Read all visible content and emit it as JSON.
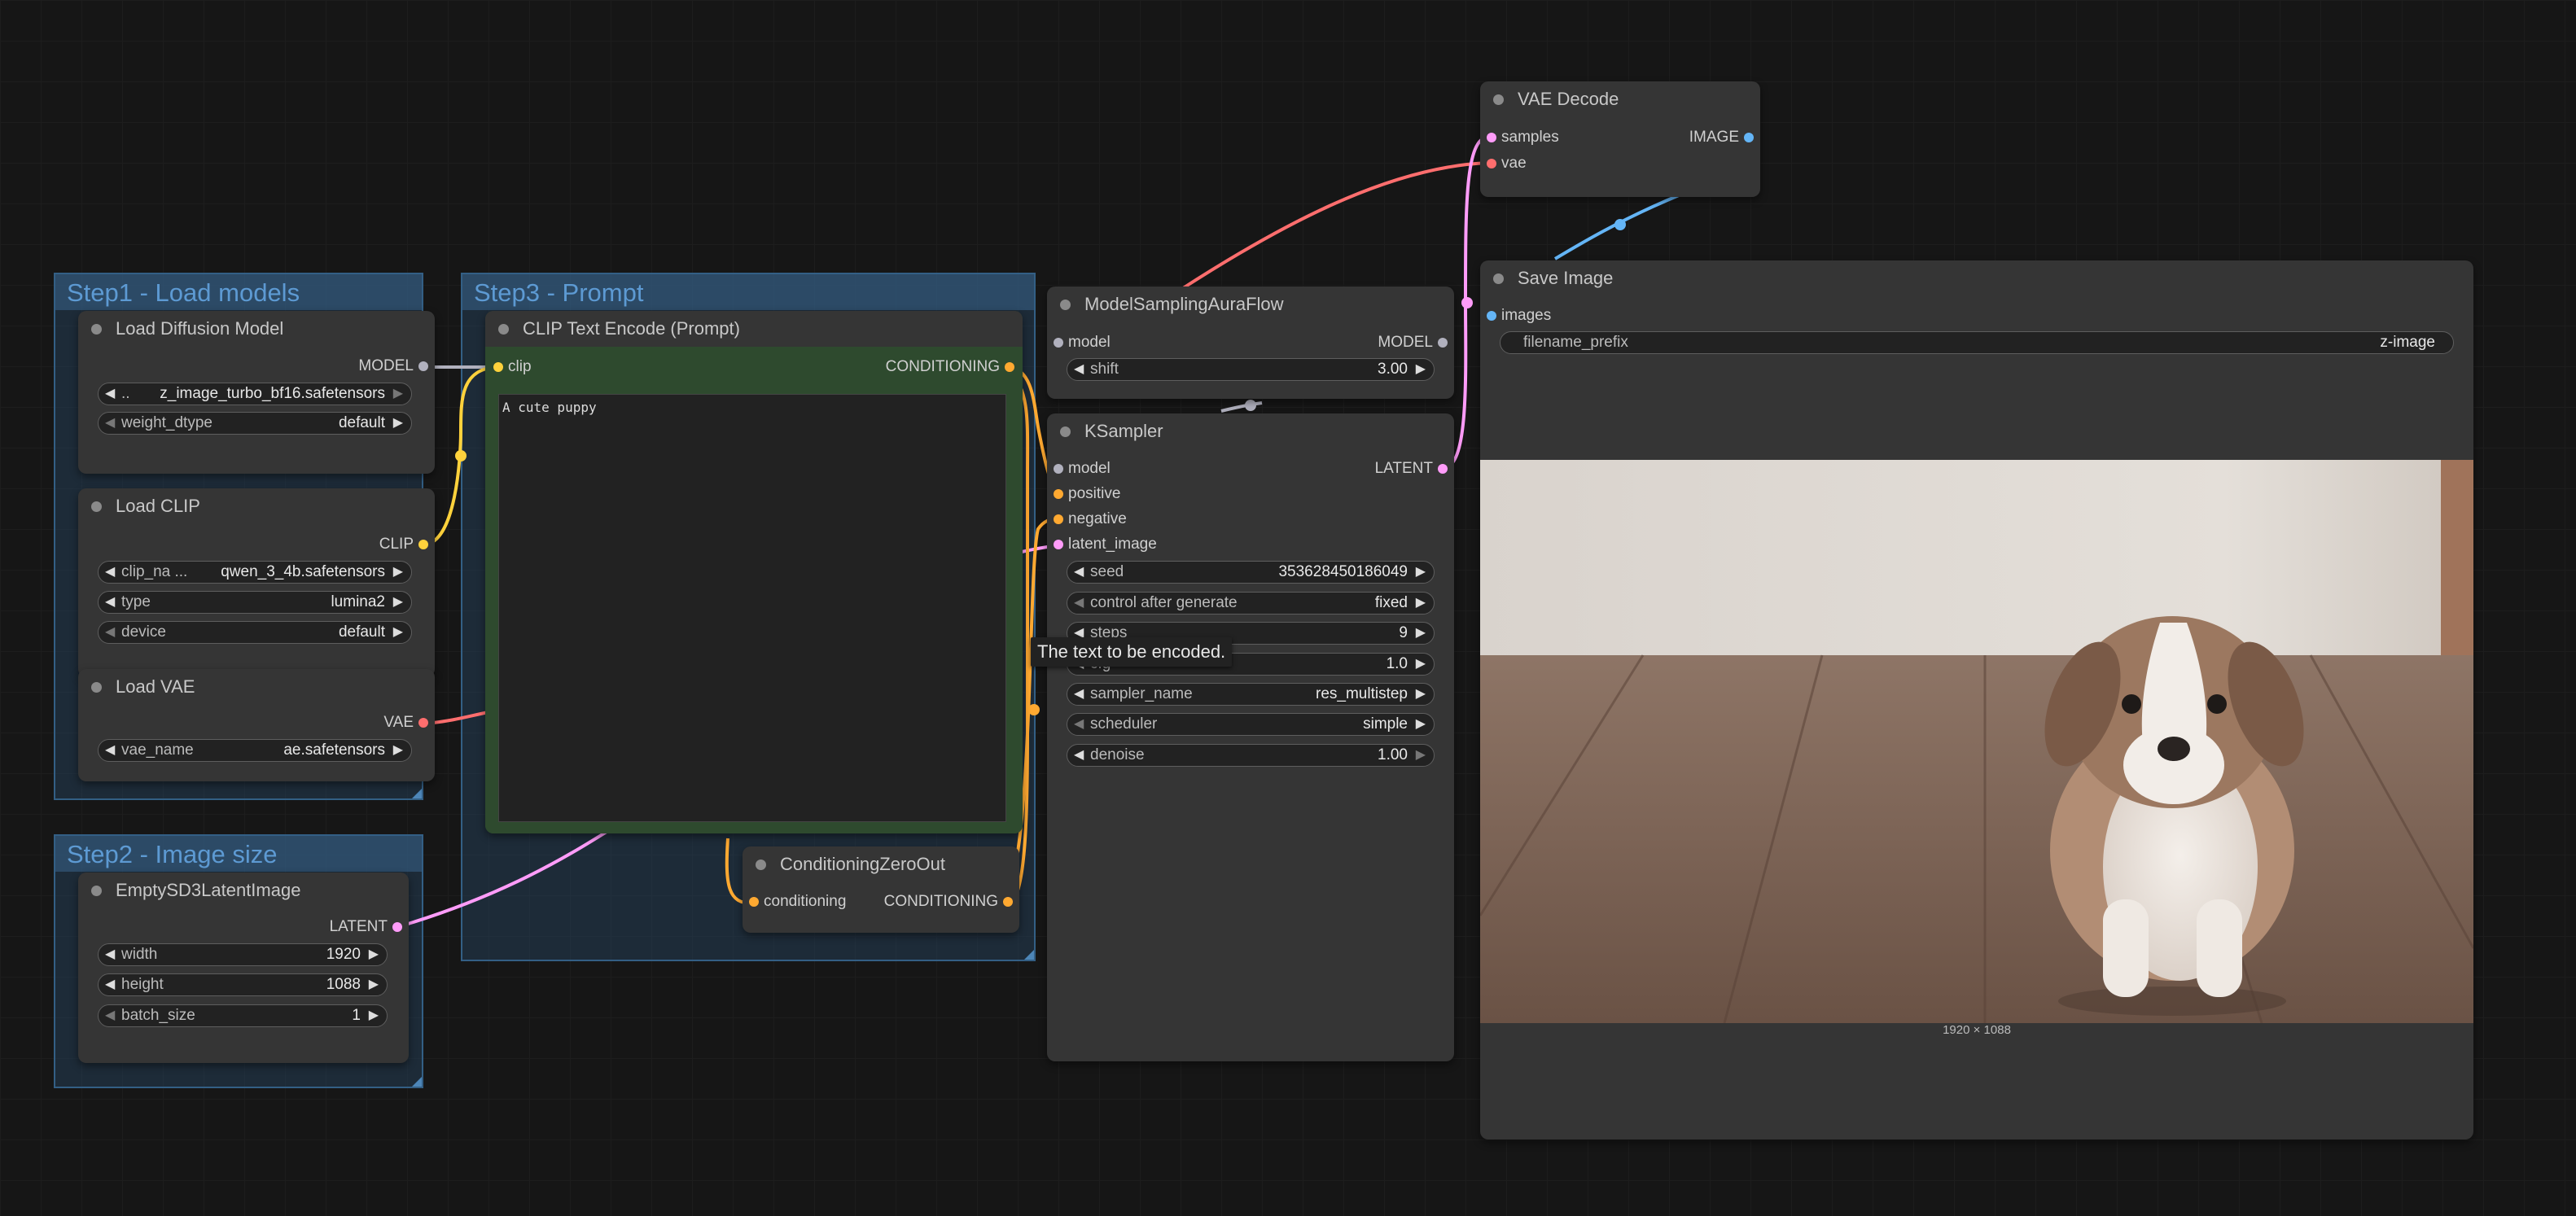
{
  "groups": {
    "step1": "Step1 - Load models",
    "step2": "Step2 - Image size",
    "step3": "Step3 - Prompt"
  },
  "nodes": {
    "load_diffusion": {
      "title": "Load Diffusion Model",
      "output": "MODEL",
      "unet_name": {
        "label": "..",
        "value": "z_image_turbo_bf16.safetensors"
      },
      "weight_dtype": {
        "label": "weight_dtype",
        "value": "default"
      }
    },
    "load_clip": {
      "title": "Load CLIP",
      "output": "CLIP",
      "clip_name": {
        "label": "clip_na ...",
        "value": "qwen_3_4b.safetensors"
      },
      "type": {
        "label": "type",
        "value": "lumina2"
      },
      "device": {
        "label": "device",
        "value": "default"
      }
    },
    "load_vae": {
      "title": "Load VAE",
      "output": "VAE",
      "vae_name": {
        "label": "vae_name",
        "value": "ae.safetensors"
      }
    },
    "empty_latent": {
      "title": "EmptySD3LatentImage",
      "output": "LATENT",
      "width": {
        "label": "width",
        "value": "1920"
      },
      "height": {
        "label": "height",
        "value": "1088"
      },
      "batch_size": {
        "label": "batch_size",
        "value": "1"
      }
    },
    "clip_text_encode": {
      "title": "CLIP Text Encode (Prompt)",
      "input": "clip",
      "output": "CONDITIONING",
      "text": "A cute puppy"
    },
    "conditioning_zero": {
      "title": "ConditioningZeroOut",
      "input": "conditioning",
      "output": "CONDITIONING"
    },
    "model_sampling": {
      "title": "ModelSamplingAuraFlow",
      "input": "model",
      "output": "MODEL",
      "shift": {
        "label": "shift",
        "value": "3.00"
      }
    },
    "ksampler": {
      "title": "KSampler",
      "inputs": {
        "model": "model",
        "positive": "positive",
        "negative": "negative",
        "latent_image": "latent_image"
      },
      "output": "LATENT",
      "seed": {
        "label": "seed",
        "value": "353628450186049"
      },
      "control": {
        "label": "control after generate",
        "value": "fixed"
      },
      "steps": {
        "label": "steps",
        "value": "9"
      },
      "cfg": {
        "label": "cfg",
        "value": "1.0"
      },
      "sampler": {
        "label": "sampler_name",
        "value": "res_multistep"
      },
      "scheduler": {
        "label": "scheduler",
        "value": "simple"
      },
      "denoise": {
        "label": "denoise",
        "value": "1.00"
      }
    },
    "vae_decode": {
      "title": "VAE Decode",
      "inputs": {
        "samples": "samples",
        "vae": "vae"
      },
      "output": "IMAGE"
    },
    "save_image": {
      "title": "Save Image",
      "input": "images",
      "filename_prefix": {
        "label": "filename_prefix",
        "value": "z-image"
      },
      "image_size": "1920 × 1088"
    }
  },
  "tooltip": "The text to be encoded.",
  "colors": {
    "model": "#b1b1be",
    "clip": "#ffd23c",
    "vae": "#ff6e6e",
    "latent": "#ff9cf9",
    "conditioning": "#ffa931",
    "image": "#64b5f6",
    "group_fill": "#284a69",
    "group_title": "#5d9ad3"
  }
}
